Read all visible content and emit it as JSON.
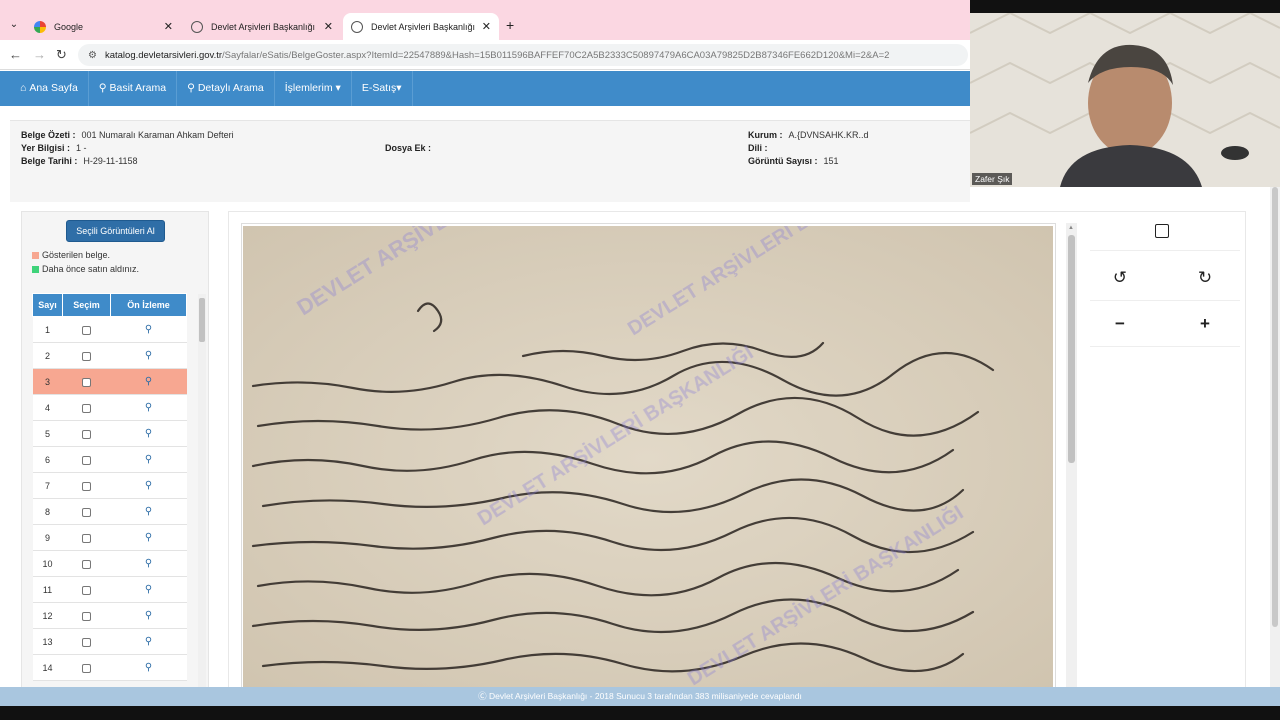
{
  "browser": {
    "tabs": [
      {
        "title": "Google",
        "active": false
      },
      {
        "title": "Devlet Arşivleri Başkanlığı",
        "active": false
      },
      {
        "title": "Devlet Arşivleri Başkanlığı",
        "active": true
      }
    ],
    "url_host": "katalog.devletarsivleri.gov.tr",
    "url_path": "/Sayfalar/eSatis/BelgeGoster.aspx?ItemId=22547889&Hash=15B011596BAFFEF70C2A5B2333C50897479A6CA03A79825D2B87346FE662D120&Mi=2&A=2"
  },
  "navbar": {
    "items": [
      "Ana Sayfa",
      "Basit Arama",
      "Detaylı Arama",
      "İşlemlerim",
      "E-Satış"
    ]
  },
  "info": {
    "belge_ozeti_label": "Belge Özeti :",
    "belge_ozeti": "001 Numaralı Karaman Ahkam Defteri",
    "yer_bilgisi_label": "Yer Bilgisi :",
    "yer_bilgisi": "1 -",
    "belge_tarihi_label": "Belge Tarihi :",
    "belge_tarihi": "H-29-11-1158",
    "dosya_ek_label": "Dosya Ek :",
    "dosya_ek": "",
    "kurum_label": "Kurum :",
    "kurum": "A.{DVNSAHK.KR..d",
    "dili_label": "Dili :",
    "dili": "",
    "goruntu_sayisi_label": "Görüntü Sayısı :",
    "goruntu_sayisi": "151"
  },
  "left_panel": {
    "select_button": "Seçili Görüntüleri Al",
    "legend_shown": "Gösterilen belge.",
    "legend_bought": "Daha önce satın aldınız.",
    "legend_shown_color": "#f7a791",
    "legend_bought_color": "#3fd37a",
    "columns": [
      "Sayı",
      "Seçim",
      "Ön İzleme"
    ],
    "rows": [
      "1",
      "2",
      "3",
      "4",
      "5",
      "6",
      "7",
      "8",
      "9",
      "10",
      "11",
      "12",
      "13",
      "14"
    ],
    "shown_row": "3"
  },
  "webcam": {
    "name": "Zafer Şık"
  },
  "footer": {
    "text": "Ⓒ Devlet Arşivleri Başkanlığı - 2018 Sunucu 3 tarafından 383 milisaniyede cevaplandı"
  },
  "colors": {
    "navbar": "#3f8bc9",
    "button": "#2f6ea7",
    "footer": "#a9c6df"
  }
}
